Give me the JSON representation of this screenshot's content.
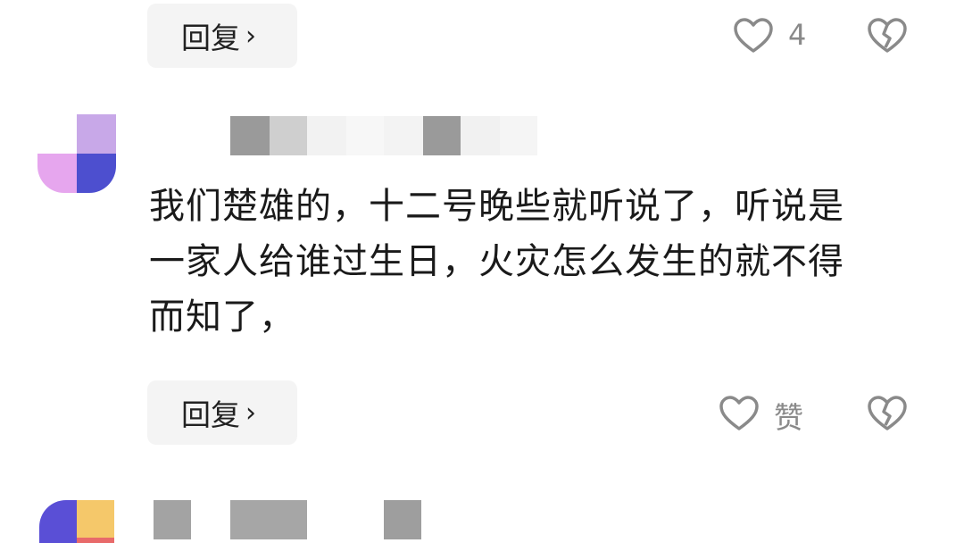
{
  "comments": [
    {
      "reply_label": "回复",
      "like_count": "4"
    },
    {
      "text_lines": [
        "我们楚雄的，十二号晚些就听说了，听说是",
        "一家人给谁过生日，火灾怎么发生的就不得",
        "而知了，"
      ],
      "reply_label": "回复",
      "like_label": "赞"
    }
  ],
  "icons": {
    "like": "heart-outline-icon",
    "dislike": "broken-heart-icon",
    "chevron": "chevron-right-icon"
  },
  "colors": {
    "reply_bg": "#f4f4f4",
    "icon_gray": "#8a8a8a",
    "text": "#1a1a1a"
  }
}
